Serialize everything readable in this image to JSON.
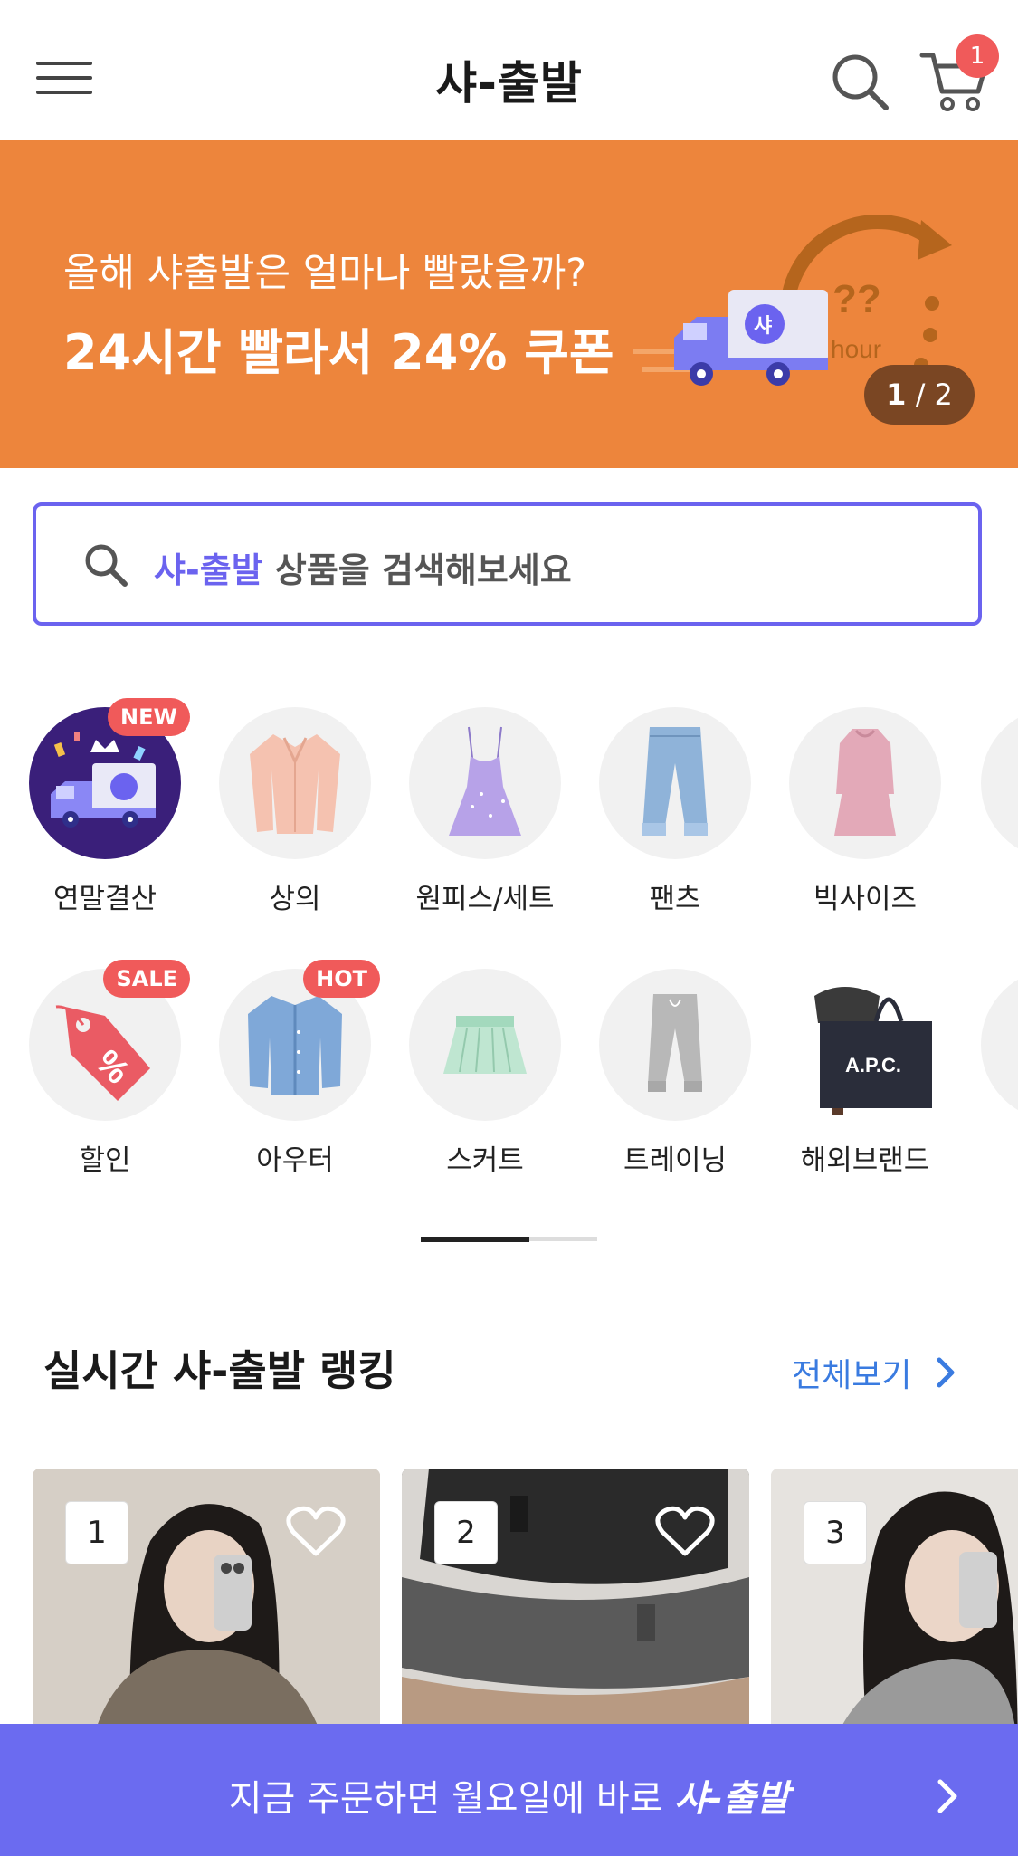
{
  "header": {
    "title": "샤-출발",
    "cart_count": "1",
    "icons": [
      "hamburger-menu-icon",
      "search-icon",
      "cart-icon"
    ]
  },
  "banner": {
    "line1": "올해 샤출발은 얼마나 빨랐을까?",
    "line2": "24시간 빨라서 24% 쿠폰",
    "art_text_q": "??",
    "art_text_hour": "hour",
    "page_current": "1",
    "page_total": "/ 2",
    "color": "#ed853c"
  },
  "search": {
    "accent": "샤-출발",
    "placeholder_rest": " 상품을 검색해보세요",
    "accent_color": "#6b63ef"
  },
  "categories_row1": [
    {
      "label": "연말결산",
      "badge": "NEW",
      "icon": "truck-icon"
    },
    {
      "label": "상의",
      "badge": "",
      "icon": "blouse-icon"
    },
    {
      "label": "원피스/세트",
      "badge": "",
      "icon": "dress-icon"
    },
    {
      "label": "팬츠",
      "badge": "",
      "icon": "jeans-icon"
    },
    {
      "label": "빅사이즈",
      "badge": "",
      "icon": "long-dress-icon"
    }
  ],
  "categories_row2": [
    {
      "label": "할인",
      "badge": "SALE",
      "icon": "price-tag-icon"
    },
    {
      "label": "아우터",
      "badge": "HOT",
      "icon": "cardigan-icon"
    },
    {
      "label": "스커트",
      "badge": "",
      "icon": "skirt-icon"
    },
    {
      "label": "트레이닝",
      "badge": "",
      "icon": "jogger-pants-icon"
    },
    {
      "label": "해외브랜드",
      "badge": "",
      "icon": "tote-bag-icon",
      "bag_text": "A.P.C."
    }
  ],
  "ranking": {
    "title": "실시간 샤-출발 랭킹",
    "see_all": "전체보기",
    "items": [
      {
        "rank": "1"
      },
      {
        "rank": "2"
      },
      {
        "rank": "3"
      }
    ]
  },
  "cta": {
    "text": "지금 주문하면 월요일에 바로 ",
    "brand": "샤-출발",
    "color": "#6b6bf0"
  }
}
